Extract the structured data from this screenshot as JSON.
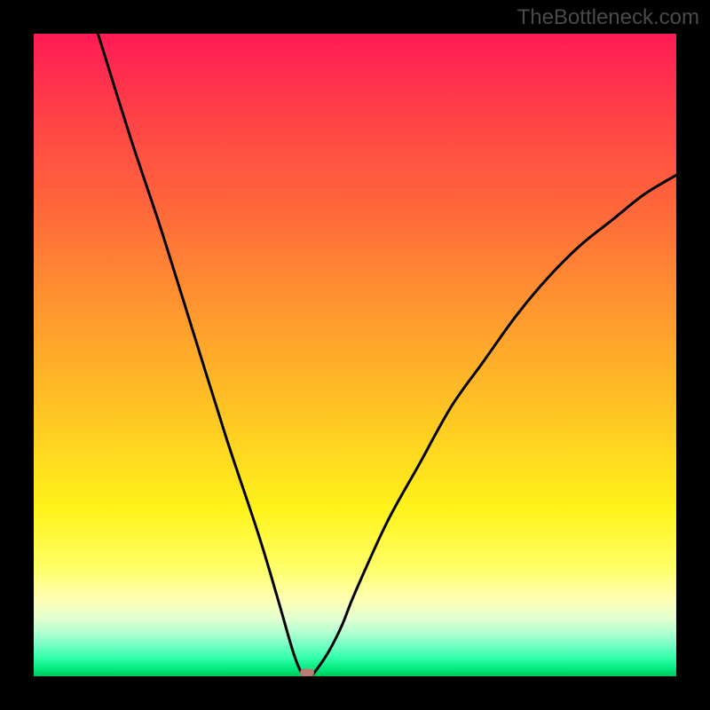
{
  "watermark": "TheBottleneck.com",
  "colors": {
    "frame": "#000000",
    "curve": "#000000",
    "marker": "#b97a74",
    "gradient_top": "#ff1a55",
    "gradient_bottom": "#00c85a"
  },
  "chart_data": {
    "type": "line",
    "title": "",
    "xlabel": "",
    "ylabel": "",
    "xlim": [
      0,
      100
    ],
    "ylim": [
      0,
      100
    ],
    "grid": false,
    "legend": false,
    "notes": "V-shaped bottleneck curve on a red-to-green vertical gradient. Left branch nearly linear from top-left corner down to the minimum; right branch rises with decreasing slope toward the upper right. Minimum near x≈42 sits on the green band at the bottom. Pink rounded marker at the minimum. No axis ticks or labels are visible.",
    "background_gradient": {
      "direction": "top-to-bottom",
      "stops": [
        {
          "pos": 0,
          "color": "#ff1a55"
        },
        {
          "pos": 12,
          "color": "#ff3f47"
        },
        {
          "pos": 28,
          "color": "#ff6a3a"
        },
        {
          "pos": 44,
          "color": "#ff9a2e"
        },
        {
          "pos": 60,
          "color": "#ffc823"
        },
        {
          "pos": 74,
          "color": "#fff31a"
        },
        {
          "pos": 83,
          "color": "#ffff66"
        },
        {
          "pos": 88,
          "color": "#ffffb3"
        },
        {
          "pos": 91,
          "color": "#e3ffd0"
        },
        {
          "pos": 93,
          "color": "#b6ffd1"
        },
        {
          "pos": 95,
          "color": "#7affc6"
        },
        {
          "pos": 97,
          "color": "#36ffad"
        },
        {
          "pos": 99,
          "color": "#00e77a"
        },
        {
          "pos": 100,
          "color": "#00c85a"
        }
      ]
    },
    "series": [
      {
        "name": "bottleneck-curve",
        "x": [
          10,
          15,
          20,
          25,
          30,
          35,
          38,
          40,
          41,
          42,
          43,
          44,
          46,
          48,
          50,
          55,
          60,
          65,
          70,
          75,
          80,
          85,
          90,
          95,
          100
        ],
        "y": [
          100,
          84,
          69,
          53,
          37,
          22,
          12,
          5,
          2,
          0,
          0,
          1,
          4,
          8,
          13,
          24,
          33,
          42,
          49,
          56,
          62,
          67,
          71,
          75,
          78
        ]
      }
    ],
    "min_point": {
      "x": 42,
      "y": 0
    },
    "marker": {
      "x": 42.5,
      "y": 0.5,
      "shape": "rounded-rect",
      "color": "#b97a74"
    }
  }
}
